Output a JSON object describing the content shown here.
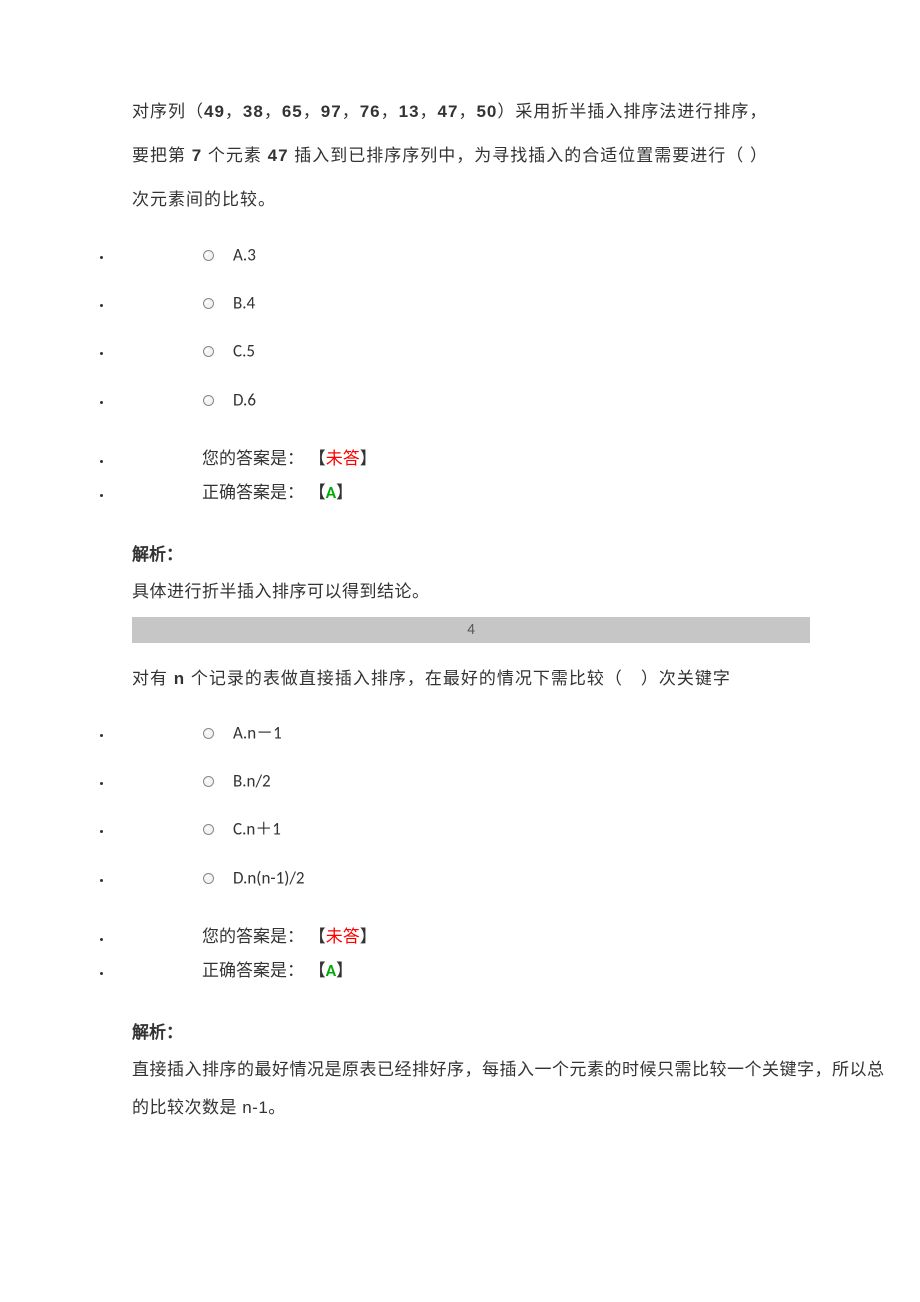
{
  "q1": {
    "text_parts": [
      {
        "t": "对序列（",
        "b": false
      },
      {
        "t": "49",
        "b": true
      },
      {
        "t": "，",
        "b": false
      },
      {
        "t": "38",
        "b": true
      },
      {
        "t": "，",
        "b": false
      },
      {
        "t": "65",
        "b": true
      },
      {
        "t": "，",
        "b": false
      },
      {
        "t": "97",
        "b": true
      },
      {
        "t": "，",
        "b": false
      },
      {
        "t": "76",
        "b": true
      },
      {
        "t": "，",
        "b": false
      },
      {
        "t": "13",
        "b": true
      },
      {
        "t": "，",
        "b": false
      },
      {
        "t": "47",
        "b": true
      },
      {
        "t": "，",
        "b": false
      },
      {
        "t": "50",
        "b": true
      },
      {
        "t": "）采用折半插入排序法进行排序，",
        "b": false
      }
    ],
    "line2_parts": [
      {
        "t": "要把第 ",
        "b": false
      },
      {
        "t": "7",
        "b": true
      },
      {
        "t": " 个元素 ",
        "b": false
      },
      {
        "t": "47",
        "b": true
      },
      {
        "t": " 插入到已排序序列中，为寻找插入的合适位置需要进行（ ）",
        "b": false
      }
    ],
    "line3": "次元素间的比较。",
    "options": [
      {
        "label": "A.3"
      },
      {
        "label": "B.4"
      },
      {
        "label": "C.5"
      },
      {
        "label": "D.6"
      }
    ],
    "your_answer_label": "您的答案是：",
    "your_answer_value": "未答",
    "correct_answer_label": "正确答案是：",
    "correct_answer_value": "A",
    "bracket_open": "【",
    "bracket_close": "】",
    "explanation_title": "解析：",
    "explanation_text": "具体进行折半插入排序可以得到结论。"
  },
  "divider": "4",
  "q2": {
    "text_parts": [
      {
        "t": "对有 ",
        "b": false
      },
      {
        "t": "n",
        "b": true
      },
      {
        "t": " 个记录的表做直接插入排序，在最好的情况下需比较（　）次关键字",
        "b": false
      }
    ],
    "options": [
      {
        "label": "A.n－1"
      },
      {
        "label": "B.n/2"
      },
      {
        "label": "C.n＋1"
      },
      {
        "label": "D.n(n-1)/2"
      }
    ],
    "your_answer_label": "您的答案是：",
    "your_answer_value": "未答",
    "correct_answer_label": "正确答案是：",
    "correct_answer_value": "A",
    "bracket_open": "【",
    "bracket_close": "】",
    "explanation_title": "解析：",
    "explanation_text": "直接插入排序的最好情况是原表已经排好序，每插入一个元素的时候只需比较一个关键字，所以总的比较次数是 n-1。"
  }
}
